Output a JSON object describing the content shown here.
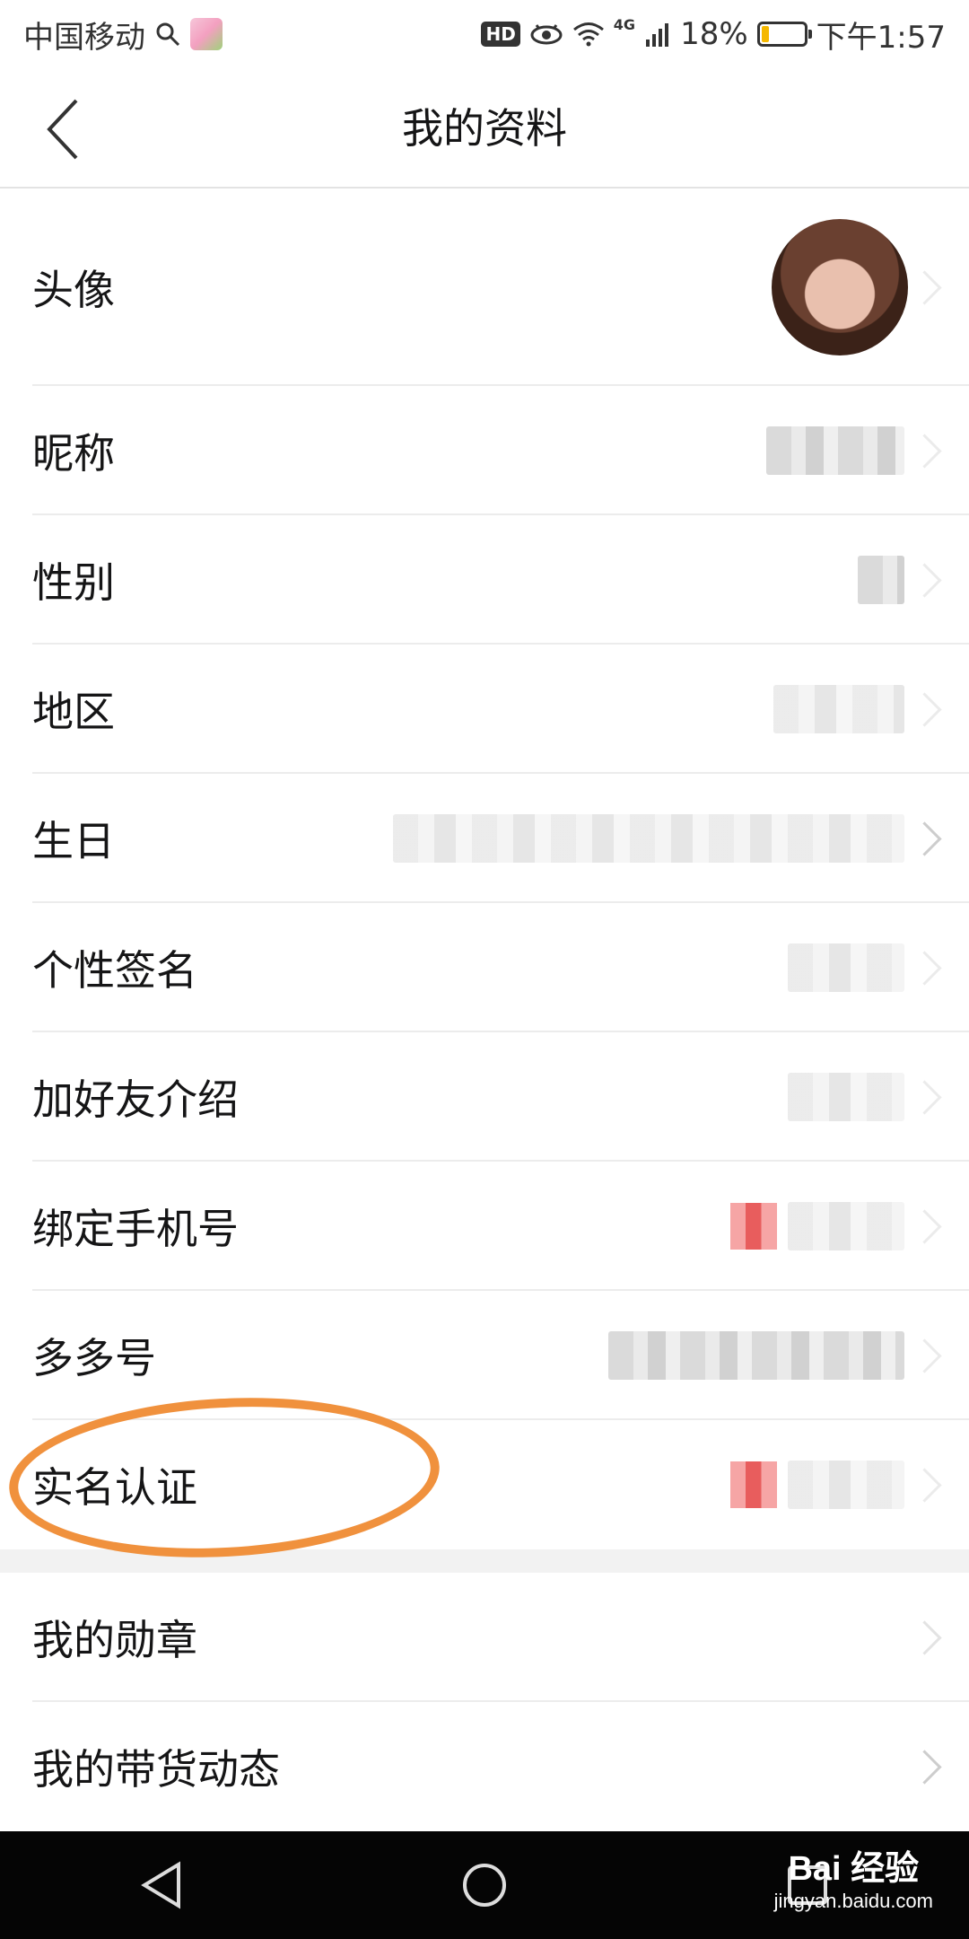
{
  "status_bar": {
    "carrier": "中国移动",
    "battery_percent": "18%",
    "time": "下午1:57",
    "network": "4G",
    "hd_badge": "HD",
    "battery_level": 0.18,
    "icons": [
      "search-icon",
      "app-notification-icon",
      "hd-icon",
      "eye-care-icon",
      "wifi-icon",
      "signal-icon",
      "battery-icon"
    ]
  },
  "header": {
    "title": "我的资料",
    "back_icon": "chevron-left-icon"
  },
  "profile_items": [
    {
      "label": "头像"
    },
    {
      "label": "昵称"
    },
    {
      "label": "性别"
    },
    {
      "label": "地区"
    },
    {
      "label": "生日"
    },
    {
      "label": "个性签名"
    },
    {
      "label": "加好友介绍"
    },
    {
      "label": "绑定手机号"
    },
    {
      "label": "多多号"
    },
    {
      "label": "实名认证"
    }
  ],
  "extra_items": [
    {
      "label": "我的勋章"
    },
    {
      "label": "我的带货动态"
    }
  ],
  "colors": {
    "highlight": "#f0913d",
    "battery": "#f5b800",
    "verified_badge": "#e85d5d"
  },
  "system_nav": {
    "icons": [
      "back-triangle-icon",
      "home-icon",
      "recents-square-icon"
    ]
  },
  "watermark": {
    "main": "Bai 经验",
    "sub": "jingyan.baidu.com"
  }
}
